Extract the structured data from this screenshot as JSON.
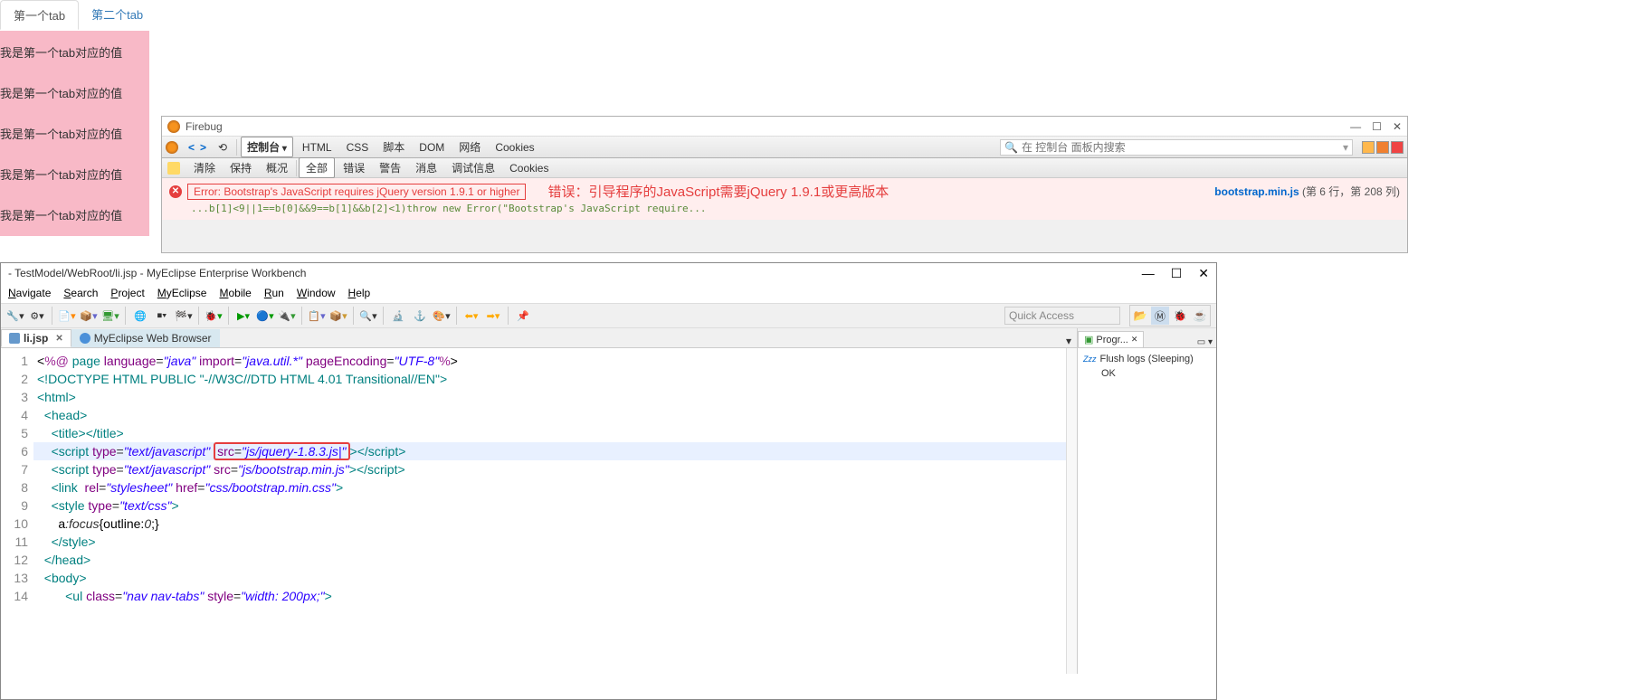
{
  "browser": {
    "tabs": [
      {
        "label": "第一个tab",
        "active": true
      },
      {
        "label": "第二个tab",
        "active": false
      }
    ],
    "content_lines": [
      "我是第一个tab对应的值",
      "我是第一个tab对应的值",
      "我是第一个tab对应的值",
      "我是第一个tab对应的值",
      "我是第一个tab对应的值"
    ]
  },
  "firebug": {
    "title": "Firebug",
    "search_placeholder": "在 控制台 面板内搜索",
    "main_tabs": [
      "控制台",
      "HTML",
      "CSS",
      "脚本",
      "DOM",
      "网络",
      "Cookies"
    ],
    "sub_tabs": [
      "清除",
      "保持",
      "概况",
      "全部",
      "错误",
      "警告",
      "消息",
      "调试信息",
      "Cookies"
    ],
    "error_msg": "Error: Bootstrap's JavaScript requires jQuery version 1.9.1 or higher",
    "annotation": "错误：引导程序的JavaScript需要jQuery 1.9.1或更高版本",
    "error_src_file": "bootstrap.min.js",
    "error_src_loc": "(第 6 行，第 208 列)",
    "stack": "...b[1]<9||1==b[0]&&9==b[1]&&b[2]<1)throw new Error(\"Bootstrap's JavaScript require..."
  },
  "eclipse": {
    "title": "- TestModel/WebRoot/li.jsp - MyEclipse Enterprise Workbench",
    "menu": [
      "Navigate",
      "Search",
      "Project",
      "MyEclipse",
      "Mobile",
      "Run",
      "Window",
      "Help"
    ],
    "quick_access": "Quick Access",
    "tabs": [
      {
        "label": "li.jsp",
        "active": true
      },
      {
        "label": "MyEclipse Web Browser",
        "active": false
      }
    ],
    "progress_view": {
      "title": "Progr...",
      "item_title": "Flush logs (Sleeping)",
      "item_status": "OK",
      "zzz": "Zzz"
    },
    "code_lines": [
      {
        "n": 1,
        "html": "<span class='c-text'>&lt;</span><span class='c-keyword'>%@</span> <span class='c-tag'>page</span> <span class='c-attr'>language</span>=<span class='c-string'>\"java\"</span> <span class='c-attr'>import</span>=<span class='c-string'>\"java.util.*\"</span> <span class='c-attr'>pageEncoding</span>=<span class='c-string'>\"UTF-8\"</span><span class='c-keyword'>%</span><span class='c-text'>&gt;</span>"
      },
      {
        "n": 2,
        "html": "<span class='c-doctype'>&lt;!DOCTYPE HTML PUBLIC \"-//W3C//DTD HTML 4.01 Transitional//EN\"&gt;</span>"
      },
      {
        "n": 3,
        "html": "<span class='c-tag'>&lt;html&gt;</span>"
      },
      {
        "n": 4,
        "html": "  <span class='c-tag'>&lt;head&gt;</span>"
      },
      {
        "n": 5,
        "html": "    <span class='c-tag'>&lt;title&gt;&lt;/title&gt;</span>"
      },
      {
        "n": 6,
        "hl": true,
        "html": "    <span class='c-tag'>&lt;script</span> <span class='c-attr'>type</span>=<span class='c-string'>\"text/javascript\"</span> <span class='hl-box'><span class='c-attr'>src</span>=<span class='c-string'>\"js/jquery-1.8.3.js|\"</span></span><span class='c-tag'>&gt;&lt;/script&gt;</span>"
      },
      {
        "n": 7,
        "html": "    <span class='c-tag'>&lt;script</span> <span class='c-attr'>type</span>=<span class='c-string'>\"text/javascript\"</span> <span class='c-attr'>src</span>=<span class='c-string'>\"js/bootstrap.min.js\"</span><span class='c-tag'>&gt;&lt;/script&gt;</span>"
      },
      {
        "n": 8,
        "html": "    <span class='c-tag'>&lt;link</span>  <span class='c-attr'>rel</span>=<span class='c-string'>\"stylesheet\"</span> <span class='c-attr'>href</span>=<span class='c-string'>\"css/bootstrap.min.css\"</span><span class='c-tag'>&gt;</span>"
      },
      {
        "n": 9,
        "html": "    <span class='c-tag'>&lt;style</span> <span class='c-attr'>type</span>=<span class='c-string'>\"text/css\"</span><span class='c-tag'>&gt;</span>"
      },
      {
        "n": 10,
        "html": "      <span class='c-text'>a</span><span class='c-cssprop'>:focus</span><span class='c-text'>{outline:</span><span class='c-cssprop'>0</span><span class='c-text'>;}</span>"
      },
      {
        "n": 11,
        "html": "    <span class='c-tag'>&lt;/style&gt;</span>"
      },
      {
        "n": 12,
        "html": "  <span class='c-tag'>&lt;/head&gt;</span>"
      },
      {
        "n": 13,
        "html": "  <span class='c-tag'>&lt;body&gt;</span>"
      },
      {
        "n": 14,
        "html": "        <span class='c-tag'>&lt;ul</span> <span class='c-attr'>class</span>=<span class='c-string'>\"nav nav-tabs\"</span> <span class='c-attr'>style</span>=<span class='c-string'>\"width: 200px;\"</span><span class='c-tag'>&gt;</span>"
      }
    ]
  }
}
